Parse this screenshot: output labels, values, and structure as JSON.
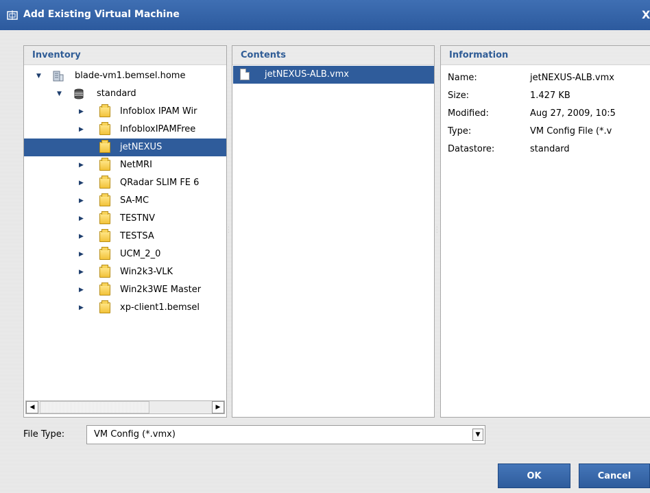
{
  "dialog": {
    "title": "Add Existing Virtual Machine",
    "close_label": "X"
  },
  "inventory": {
    "header": "Inventory",
    "root": "blade-vm1.bemsel.home",
    "datastore": "standard",
    "folders": [
      {
        "label": "Infoblox IPAM Wir",
        "selected": false
      },
      {
        "label": "InfobloxIPAMFree",
        "selected": false
      },
      {
        "label": "jetNEXUS",
        "selected": true
      },
      {
        "label": "NetMRI",
        "selected": false
      },
      {
        "label": "QRadar SLIM FE 6",
        "selected": false
      },
      {
        "label": "SA-MC",
        "selected": false
      },
      {
        "label": "TESTNV",
        "selected": false
      },
      {
        "label": "TESTSA",
        "selected": false
      },
      {
        "label": "UCM_2_0",
        "selected": false
      },
      {
        "label": "Win2k3-VLK",
        "selected": false
      },
      {
        "label": "Win2k3WE Master",
        "selected": false
      },
      {
        "label": "xp-client1.bemsel",
        "selected": false
      }
    ]
  },
  "contents": {
    "header": "Contents",
    "items": [
      {
        "label": "jetNEXUS-ALB.vmx"
      }
    ]
  },
  "information": {
    "header": "Information",
    "rows": [
      {
        "key": "Name:",
        "value": "jetNEXUS-ALB.vmx"
      },
      {
        "key": "Size:",
        "value": "1.427 KB"
      },
      {
        "key": "Modified:",
        "value": "Aug 27, 2009, 10:5"
      },
      {
        "key": "Type:",
        "value": "VM Config File (*.v"
      },
      {
        "key": "Datastore:",
        "value": "standard"
      }
    ]
  },
  "file_type": {
    "label": "File Type:",
    "value": "VM Config (*.vmx)"
  },
  "buttons": {
    "ok": "OK",
    "cancel": "Cancel"
  },
  "colors": {
    "accent": "#2f5c9b",
    "header_text": "#2f5c96"
  }
}
